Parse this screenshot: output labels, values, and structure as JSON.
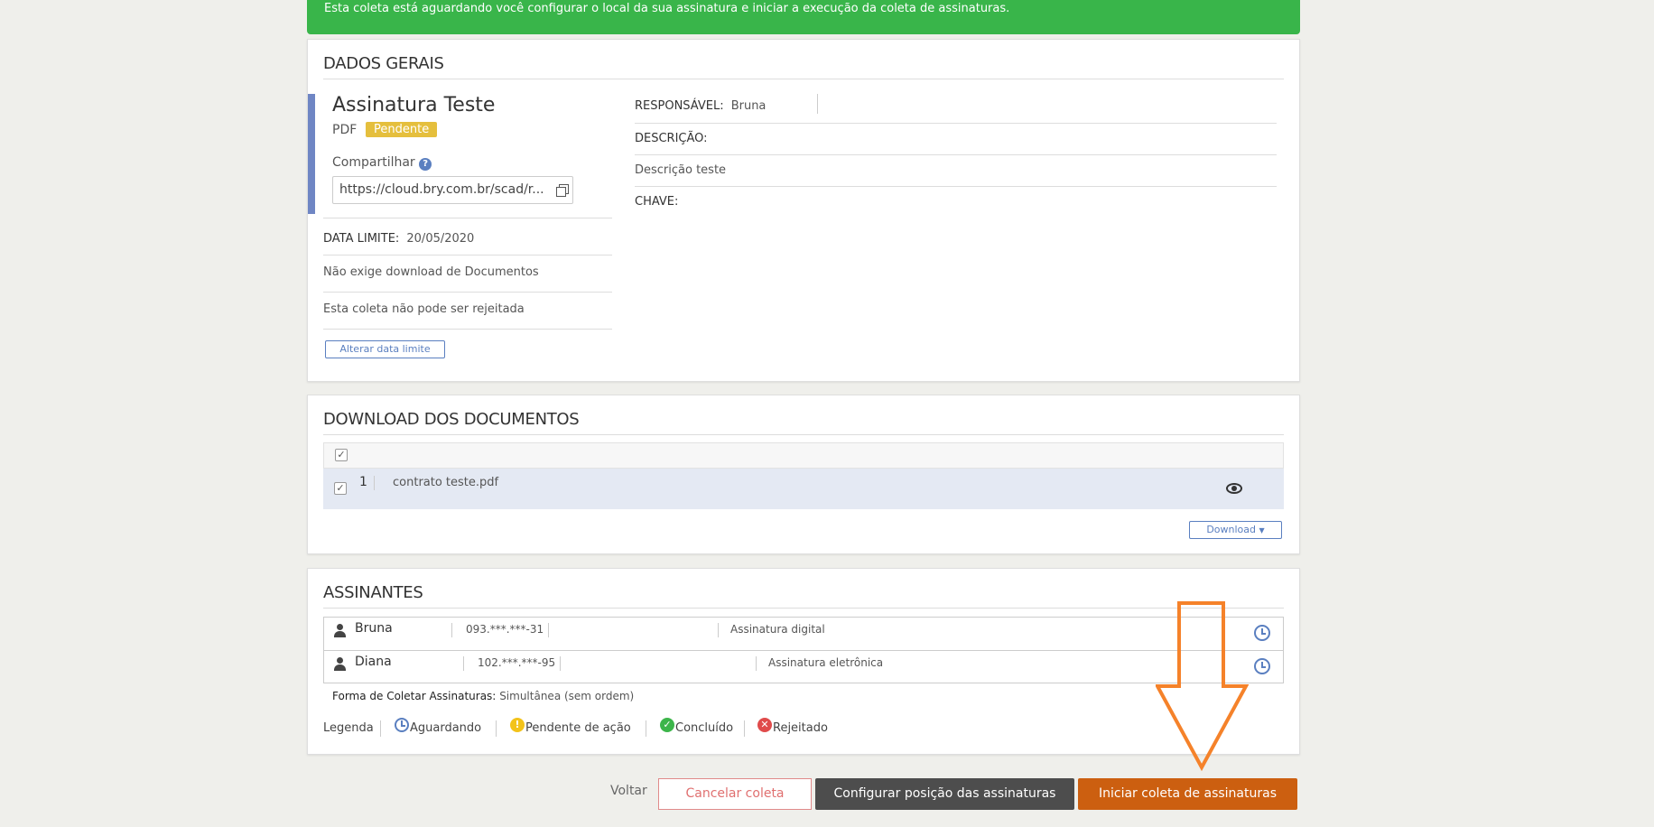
{
  "banner": {
    "text": "Esta coleta está aguardando você configurar o local da sua assinatura e iniciar a execução da coleta de assinaturas."
  },
  "dados_gerais": {
    "title": "DADOS GERAIS",
    "doc_name": "Assinatura Teste",
    "doc_type": "PDF",
    "status_badge": "Pendente",
    "share_label": "Compartilhar",
    "share_url": "https://cloud.bry.com.br/scad/r...",
    "deadline_label": "DATA LIMITE:",
    "deadline_value": "20/05/2020",
    "download_note": "Não exige download de Documentos",
    "reject_note": "Esta coleta não pode ser rejeitada",
    "change_deadline_button": "Alterar data limite",
    "responsavel_label": "RESPONSÁVEL:",
    "responsavel_value": "Bruna",
    "descricao_label": "DESCRIÇÃO:",
    "descricao_value": "Descrição teste",
    "chave_label": "CHAVE:"
  },
  "downloads": {
    "title": "DOWNLOAD DOS DOCUMENTOS",
    "rows": [
      {
        "index": "1",
        "filename": "contrato teste.pdf"
      }
    ],
    "download_button": "Download"
  },
  "assinantes": {
    "title": "ASSINANTES",
    "signers": [
      {
        "name": "Bruna",
        "cpf": "093.***.***-31",
        "type": "Assinatura digital"
      },
      {
        "name": "Diana",
        "cpf": "102.***.***-95",
        "type": "Assinatura eletrônica"
      }
    ],
    "mode_label": "Forma de Coletar Assinaturas:",
    "mode_value": "Simultânea (sem ordem)",
    "legend_label": "Legenda",
    "legend": [
      {
        "label": "Aguardando",
        "icon": "clock-icon",
        "color": "#5a7fc0"
      },
      {
        "label": "Pendente de ação",
        "icon": "exclamation-icon",
        "color": "#f3c31a"
      },
      {
        "label": "Concluído",
        "icon": "check-circle-icon",
        "color": "#3cb54a"
      },
      {
        "label": "Rejeitado",
        "icon": "x-circle-icon",
        "color": "#e04b4b"
      }
    ]
  },
  "footer": {
    "back": "Voltar",
    "cancel": "Cancelar coleta",
    "configure": "Configurar posição das assinaturas",
    "start": "Iniciar coleta de assinaturas"
  },
  "colors": {
    "accent_orange": "#cc5f10",
    "arrow_orange": "#f5822a",
    "banner_green": "#39b54a",
    "badge_yellow": "#e5bf3d"
  }
}
